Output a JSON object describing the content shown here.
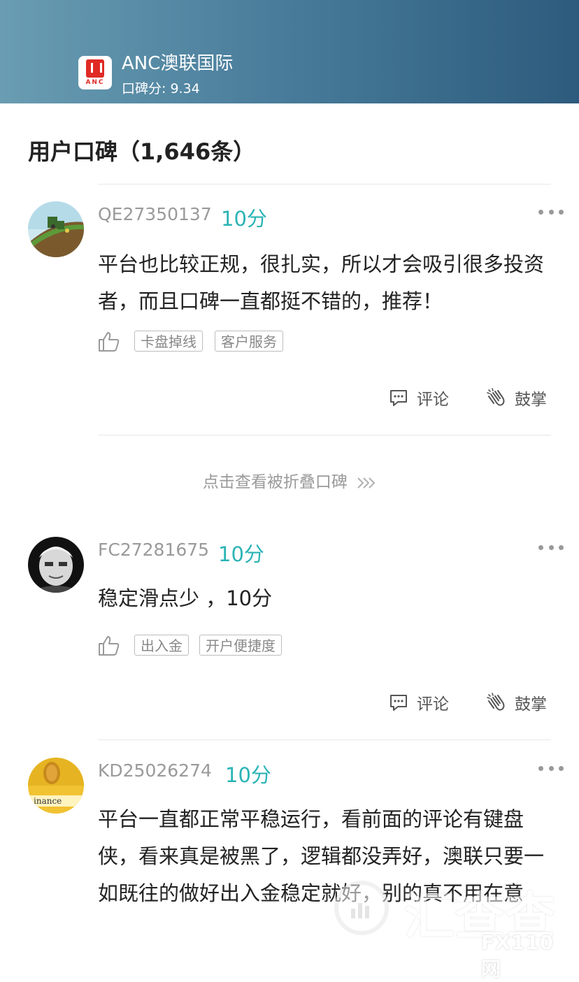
{
  "header": {
    "logo_text": "ANC",
    "app_name": "ANC澳联国际",
    "score_label": "口碑分: 9.34"
  },
  "section_title": "用户口碑（1,646条）",
  "reviews": [
    {
      "username": "QE27350137",
      "score": "10分",
      "content": "平台也比较正规，很扎实，所以才会吸引很多投资者，而且口碑一直都挺不错的，推荐！",
      "tags": [
        "卡盘掉线",
        "客户服务"
      ],
      "comment_label": "评论",
      "applaud_label": "鼓掌"
    },
    {
      "username": "FC27281675",
      "score": "10分",
      "content": "稳定滑点少 ，10分",
      "tags": [
        "出入金",
        "开户便捷度"
      ],
      "comment_label": "评论",
      "applaud_label": "鼓掌"
    },
    {
      "username": "KD25026274",
      "score": "10分",
      "content": "平台一直都正常平稳运行，看前面的评论有键盘侠，看来真是被黑了，逻辑都没弄好，澳联只要一如既往的做好出入金稳定就好，别的真不用在意"
    }
  ],
  "fold_link": "点击查看被折叠口碑",
  "watermark": {
    "text": "汇查查",
    "site": "FX110网"
  }
}
